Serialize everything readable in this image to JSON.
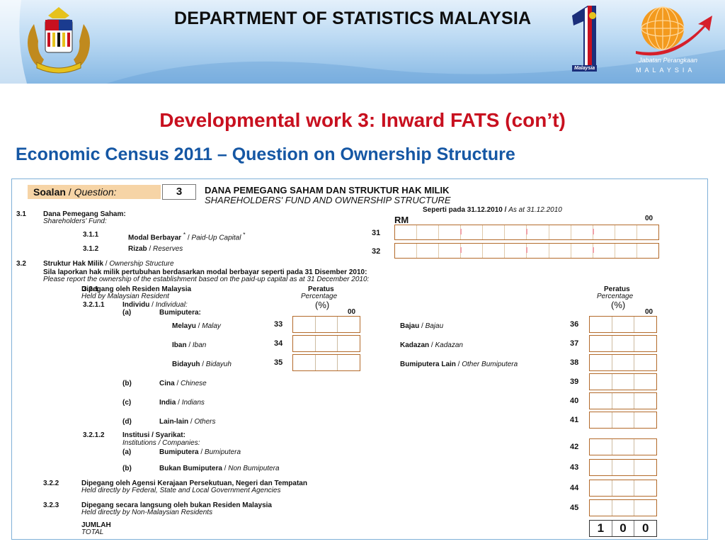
{
  "banner": {
    "title": "DEPARTMENT OF STATISTICS MALAYSIA",
    "one_tag": "Malaysia",
    "dept_line1": "Jabatan Perangkaan",
    "dept_line2": "MALAYSIA"
  },
  "slide": {
    "title": "Developmental work 3: Inward FATS (con’t)",
    "subtitle": "Economic Census 2011 – Question on Ownership Structure"
  },
  "form": {
    "soalan": "Soalan",
    "question": "Question:",
    "qnum": "3",
    "header_bm": "DANA PEMEGANG SAHAM DAN STRUKTUR HAK MILIK",
    "header_en": "SHAREHOLDERS' FUND AND OWNERSHIP STRUCTURE",
    "s31_num": "3.1",
    "s31_bm": "Dana Pemegang Saham:",
    "s31_en": "Shareholders' Fund:",
    "as_at_bm": "Seperti pada 31.12.2010",
    "as_at_en": "As at 31.12.2010",
    "rm": "RM",
    "zero_zero": "00",
    "s311_num": "3.1.1",
    "s311_bm": "Modal Berbayar",
    "s311_en": "Paid-Up Capital",
    "code31": "31",
    "s312_num": "3.1.2",
    "s312_bm": "Rizab",
    "s312_en": "Reserves",
    "code32": "32",
    "s32_num": "3.2",
    "s32_bm": "Struktur Hak Milik",
    "s32_en": "Ownership Structure",
    "instr_bm": "Sila laporkan hak milik pertubuhan berdasarkan modal berbayar seperti pada 31 Disember 2010:",
    "instr_en": "Please report the ownership of the establishment based on the paid-up capital as at 31 December 2010:",
    "s321_num": "3.2.1",
    "s321_bm": "Dipegang oleh Residen Malaysia",
    "s321_en": "Held by Malaysian Resident",
    "peratus": "Peratus",
    "percentage": "Percentage",
    "pct_sign": "(%)",
    "s3211_num": "3.2.1.1",
    "s3211_bm": "Individu",
    "s3211_en": "Individual:",
    "a": "(a)",
    "bumiputera": "Bumiputera:",
    "melayu_bm": "Melayu",
    "melayu_en": "Malay",
    "code33": "33",
    "iban_bm": "Iban",
    "iban_en": "Iban",
    "code34": "34",
    "bidayuh_bm": "Bidayuh",
    "bidayuh_en": "Bidayuh",
    "code35": "35",
    "bajau_bm": "Bajau",
    "bajau_en": "Bajau",
    "code36": "36",
    "kadazan_bm": "Kadazan",
    "kadazan_en": "Kadazan",
    "code37": "37",
    "bumilain_bm": "Bumiputera Lain",
    "bumilain_en": "Other Bumiputera",
    "code38": "38",
    "b": "(b)",
    "cina_bm": "Cina",
    "cina_en": "Chinese",
    "code39": "39",
    "c": "(c)",
    "india_bm": "India",
    "india_en": "Indians",
    "code40": "40",
    "d": "(d)",
    "lain_bm": "Lain-lain",
    "lain_en": "Others",
    "code41": "41",
    "s3212_num": "3.2.1.2",
    "s3212_bm": "Institusi / Syarikat:",
    "s3212_en": "Institutions / Companies:",
    "inst_a_bm": "Bumiputera",
    "inst_a_en": "Bumiputera",
    "code42": "42",
    "inst_b_bm": "Bukan Bumiputera",
    "inst_b_en": "Non Bumiputera",
    "code43": "43",
    "s322_num": "3.2.2",
    "s322_bm": "Dipegang oleh Agensi Kerajaan Persekutuan, Negeri dan Tempatan",
    "s322_en": "Held directly by Federal, State and Local Government Agencies",
    "code44": "44",
    "s323_num": "3.2.3",
    "s323_bm": "Dipegang secara langsung oleh bukan Residen Malaysia",
    "s323_en": "Held directly by Non-Malaysian Residents",
    "code45": "45",
    "jumlah": "JUMLAH",
    "total": "TOTAL",
    "total_digits": [
      "1",
      "0",
      "0"
    ]
  }
}
